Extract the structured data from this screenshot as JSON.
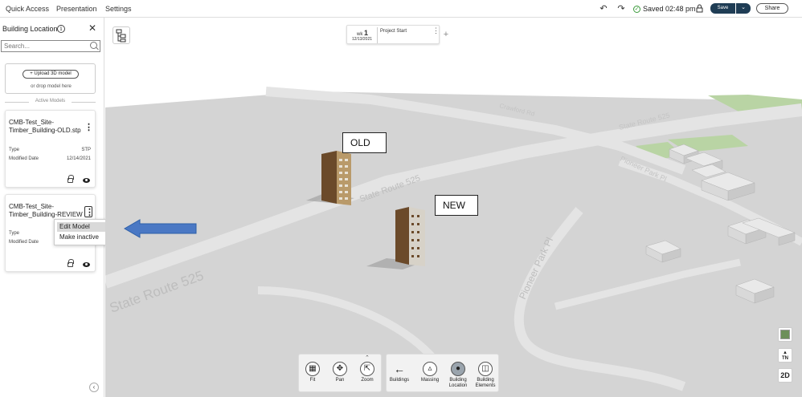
{
  "topbar": {
    "menu": [
      "Quick Access",
      "Presentation",
      "Settings"
    ],
    "saved_text": "Saved 02:48 pm",
    "save_label": "Save",
    "share_label": "Share"
  },
  "panel": {
    "title": "Building Location",
    "search_placeholder": "Search...",
    "upload_label": "+ Upload 3D model",
    "drop_text": "or drop model here",
    "active_models_label": "Active Models",
    "models": [
      {
        "name": "CMB-Test_Site-Timber_Building-OLD.stp",
        "type_label": "Type",
        "type_value": "STP",
        "modified_label": "Modified Date",
        "modified_value": "12/14/2021"
      },
      {
        "name": "CMB-Test_Site-Timber_Building-REVIEW",
        "type_label": "Type",
        "modified_label": "Modified Date"
      }
    ],
    "context_menu": [
      "Edit Model",
      "Make inactive"
    ]
  },
  "timeline": {
    "wk_prefix": "wk",
    "wk_number": "1",
    "date": "12/13/2021",
    "title": "Project Start"
  },
  "map": {
    "labels": {
      "old": "OLD",
      "new": "NEW"
    },
    "roads": [
      "State Route 525",
      "State Route 525",
      "State Route 525",
      "Pioneer Park Pl",
      "Pioneer Park Pl",
      "Crawford Rd"
    ]
  },
  "toolbar": {
    "nav_tools": [
      {
        "label": "Fit",
        "icon": "fit-icon"
      },
      {
        "label": "Pan",
        "icon": "pan-icon"
      },
      {
        "label": "Zoom",
        "icon": "zoom-icon"
      }
    ],
    "view_tools": [
      {
        "label": "Buildings",
        "icon": "back-arrow-icon"
      },
      {
        "label": "Massing",
        "icon": "massing-icon"
      },
      {
        "label": "Building Location",
        "icon": "building-location-icon",
        "active": true
      },
      {
        "label": "Building Elements",
        "icon": "building-elements-icon"
      }
    ]
  },
  "right_controls": {
    "compass": "TN",
    "view_mode": "2D"
  },
  "colors": {
    "save_button": "#1f3d55",
    "arrow": "#4a78c4",
    "ground": "#d4d4d4",
    "road": "#e6e6e6",
    "grass": "#b9d4a4"
  }
}
